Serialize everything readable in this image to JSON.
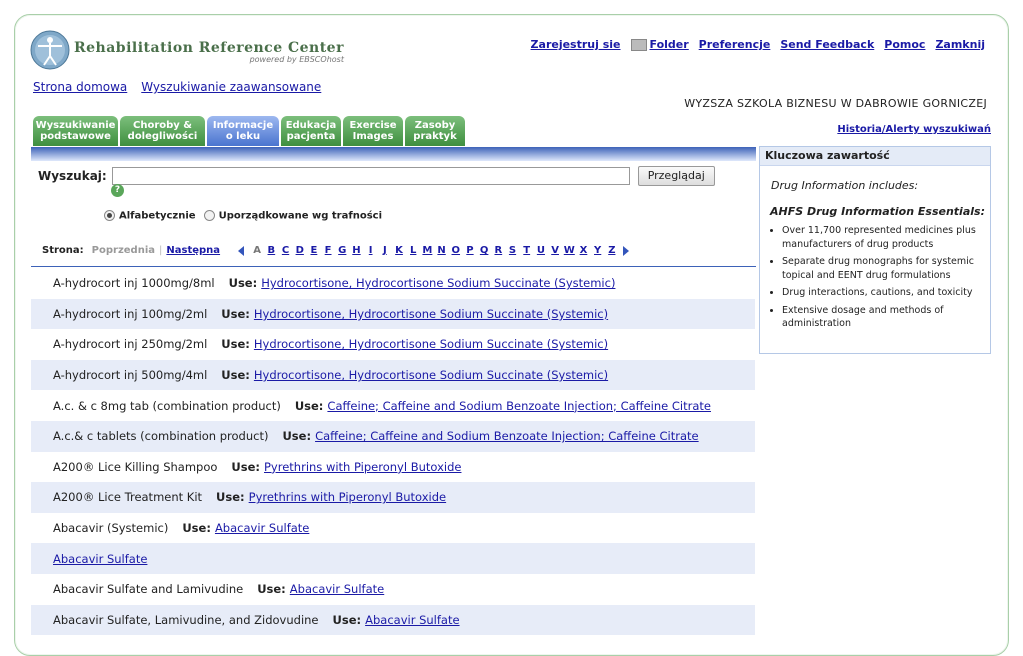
{
  "header": {
    "logo_title": "Rehabilitation Reference Center",
    "logo_sub": "powered by EBSCOhost",
    "links": [
      "Zarejestruj sie",
      "Folder",
      "Preferencje",
      "Send Feedback",
      "Pomoc",
      "Zamknij"
    ]
  },
  "subnav": [
    "Strona domowa",
    "Wyszukiwanie zaawansowane"
  ],
  "institution": "WYZSZA SZKOLA BIZNESU W DABROWIE GORNICZEJ",
  "history_link": "Historia/Alerty wyszukiwań",
  "tabs": [
    {
      "label": "Wyszukiwanie podstawowe",
      "active": false
    },
    {
      "label": "Choroby & dolegliwości",
      "active": false
    },
    {
      "label": "Informacje o leku",
      "active": true
    },
    {
      "label": "Edukacja pacjenta",
      "active": false
    },
    {
      "label": "Exercise Images",
      "active": false
    },
    {
      "label": "Zasoby praktyk",
      "active": false
    }
  ],
  "search": {
    "label": "Wyszukaj:",
    "value": "",
    "browse_button": "Przeglądaj",
    "help": "?",
    "radio_alpha": "Alfabetycznie",
    "radio_relevance": "Uporządkowane wg trafności",
    "selected": "alpha"
  },
  "pager": {
    "label": "Strona:",
    "prev": "Poprzednia",
    "separator": "|",
    "next": "Następna",
    "letters": [
      "A",
      "B",
      "C",
      "D",
      "E",
      "F",
      "G",
      "H",
      "I",
      "J",
      "K",
      "L",
      "M",
      "N",
      "O",
      "P",
      "Q",
      "R",
      "S",
      "T",
      "U",
      "V",
      "W",
      "X",
      "Y",
      "Z"
    ],
    "current_letter": "A"
  },
  "results": [
    {
      "name": "A-hydrocort inj 1000mg/8ml",
      "use_label": "Use:",
      "link": "Hydrocortisone, Hydrocortisone Sodium Succinate (Systemic)"
    },
    {
      "name": "A-hydrocort inj 100mg/2ml",
      "use_label": "Use:",
      "link": "Hydrocortisone, Hydrocortisone Sodium Succinate (Systemic)"
    },
    {
      "name": "A-hydrocort inj 250mg/2ml",
      "use_label": "Use:",
      "link": "Hydrocortisone, Hydrocortisone Sodium Succinate (Systemic)"
    },
    {
      "name": "A-hydrocort inj 500mg/4ml",
      "use_label": "Use:",
      "link": "Hydrocortisone, Hydrocortisone Sodium Succinate (Systemic)"
    },
    {
      "name": "A.c. & c 8mg tab (combination product)",
      "use_label": "Use:",
      "link": "Caffeine; Caffeine and Sodium Benzoate Injection; Caffeine Citrate"
    },
    {
      "name": "A.c.& c tablets (combination product)",
      "use_label": "Use:",
      "link": "Caffeine; Caffeine and Sodium Benzoate Injection; Caffeine Citrate"
    },
    {
      "name": "A200® Lice Killing Shampoo",
      "use_label": "Use:",
      "link": "Pyrethrins with Piperonyl Butoxide"
    },
    {
      "name": "A200® Lice Treatment Kit",
      "use_label": "Use:",
      "link": "Pyrethrins with Piperonyl Butoxide"
    },
    {
      "name": "Abacavir (Systemic)",
      "use_label": "Use:",
      "link": "Abacavir Sulfate"
    },
    {
      "name": "",
      "use_label": "",
      "link": "Abacavir Sulfate"
    },
    {
      "name": "Abacavir Sulfate and Lamivudine",
      "use_label": "Use:",
      "link": "Abacavir Sulfate"
    },
    {
      "name": "Abacavir Sulfate, Lamivudine, and Zidovudine",
      "use_label": "Use:",
      "link": "Abacavir Sulfate"
    }
  ],
  "key_content": {
    "heading": "Kluczowa zawartość",
    "intro": "Drug Information includes:",
    "subheading": "AHFS Drug Information Essentials:",
    "items": [
      "Over 11,700 represented medicines plus manufacturers of drug products",
      "Separate drug monographs for systemic topical and EENT drug formulations",
      "Drug interactions, cautions, and toxicity",
      "Extensive dosage and methods of administration"
    ]
  },
  "colors": {
    "tab_green": "#4f9a4f",
    "tab_active_blue": "#5b82d6",
    "link": "#1a1aa6",
    "alt_row": "#e7ecf8"
  }
}
